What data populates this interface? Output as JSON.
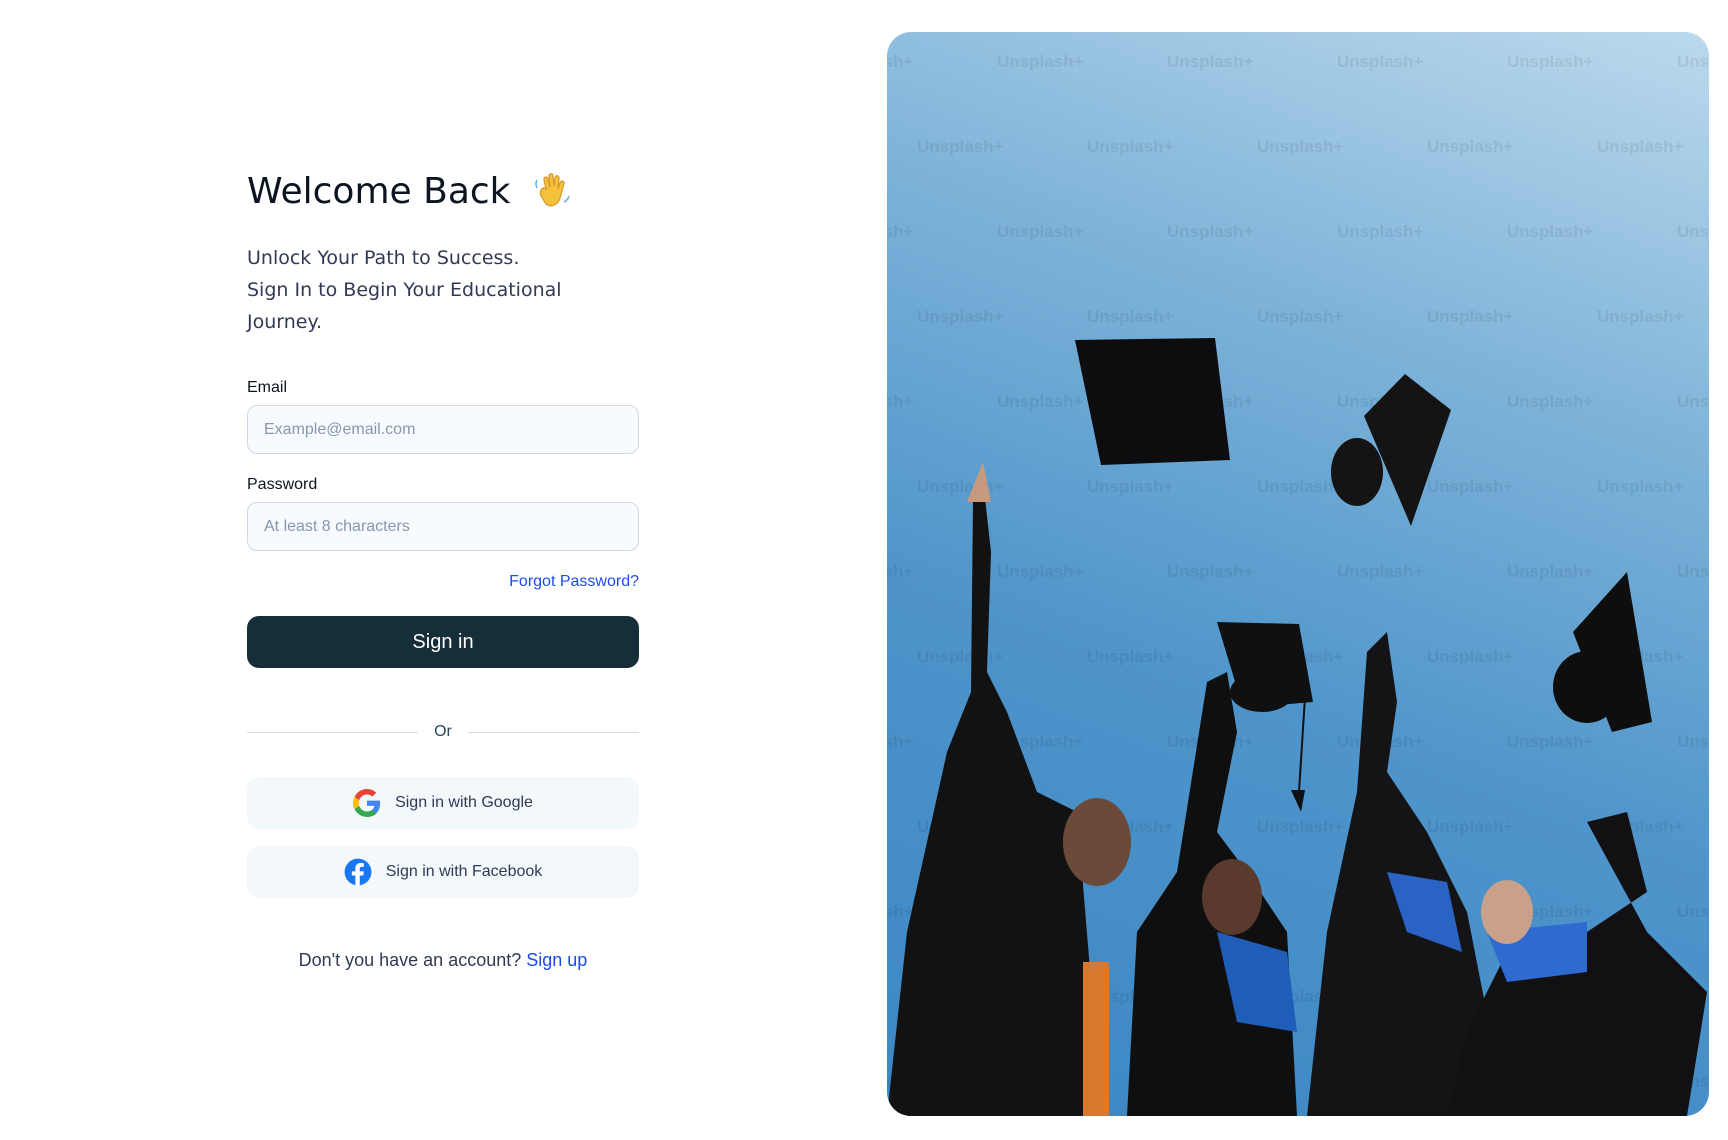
{
  "header": {
    "title": "Welcome Back",
    "wave_icon": "waving-hand-icon",
    "subtitle_line1": "Unlock Your Path to Success.",
    "subtitle_line2": "Sign In to Begin Your Educational Journey."
  },
  "form": {
    "email_label": "Email",
    "email_placeholder": "Example@email.com",
    "password_label": "Password",
    "password_placeholder": "At least 8 characters",
    "forgot_label": "Forgot Password?",
    "signin_label": "Sign in",
    "or_label": "Or"
  },
  "social": {
    "google_label": "Sign in with Google",
    "google_icon": "google-icon",
    "facebook_label": "Sign in with Facebook",
    "facebook_icon": "facebook-icon"
  },
  "footer": {
    "prompt": "Don't you have an account?",
    "signup_label": "Sign up"
  },
  "hero": {
    "description": "graduates-tossing-caps-photo",
    "watermark": "Unsplash+"
  },
  "colors": {
    "primary_button": "#162d3a",
    "link": "#1e4ae9",
    "input_bg": "#f7fbff",
    "social_bg": "#f3f9fa"
  }
}
